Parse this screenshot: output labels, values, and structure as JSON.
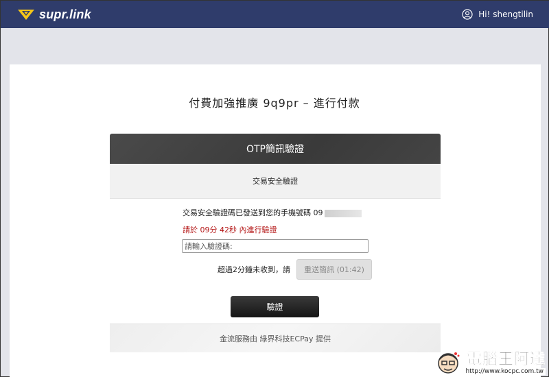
{
  "header": {
    "brand": "supr.link",
    "user_greeting": "Hi! shengtilin"
  },
  "page": {
    "title": "付費加強推廣 9q9pr – 進行付款"
  },
  "otp": {
    "panel_title": "OTP簡訊驗證",
    "subtitle": "交易安全驗證",
    "sent_message": "交易安全驗證碼已發送到您的手機號碼 09",
    "countdown": "請於 09分 42秒 內進行驗證",
    "input_placeholder": "請輸入驗證碼:",
    "resend_prompt": "超過2分鐘未收到，請",
    "resend_button": "重送簡訊 (01:42)",
    "verify_button": "驗證",
    "footer": "金流服務由 綠界科技ECPay 提供"
  },
  "watermark": {
    "title": "電腦王阿達",
    "url": "http://www.kocpc.com.tw"
  },
  "colors": {
    "topbar": "#2f3c6b",
    "logo_accent": "#f5c518",
    "countdown_red": "#b31313",
    "panel_header": "#3f3f3f"
  }
}
